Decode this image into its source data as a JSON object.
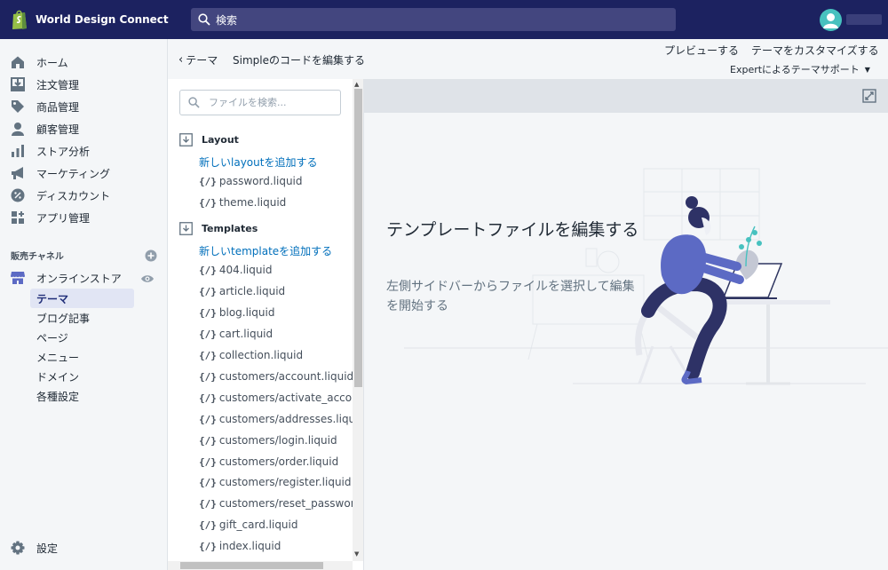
{
  "topbar": {
    "store_name": "World Design Connect",
    "search_label": "検索",
    "colors": {
      "bg": "#1c2260",
      "search_bg": "#43467f",
      "avatar": "#47c1bf"
    }
  },
  "nav": {
    "items": [
      {
        "label": "ホーム",
        "icon": "home-icon"
      },
      {
        "label": "注文管理",
        "icon": "orders-icon"
      },
      {
        "label": "商品管理",
        "icon": "tag-icon"
      },
      {
        "label": "顧客管理",
        "icon": "person-icon"
      },
      {
        "label": "ストア分析",
        "icon": "bar-chart-icon"
      },
      {
        "label": "マーケティング",
        "icon": "megaphone-icon"
      },
      {
        "label": "ディスカウント",
        "icon": "discount-icon"
      },
      {
        "label": "アプリ管理",
        "icon": "apps-icon"
      }
    ],
    "channels_heading": "販売チャネル",
    "online_store": "オンラインストア",
    "sub_items": [
      "テーマ",
      "ブログ記事",
      "ページ",
      "メニュー",
      "ドメイン",
      "各種設定"
    ],
    "settings": "設定"
  },
  "header": {
    "back_label": "テーマ",
    "title": "Simpleのコードを編集する",
    "preview": "プレビューする",
    "customize": "テーマをカスタマイズする",
    "expert": "Expertによるテーマサポート"
  },
  "files": {
    "search_placeholder": "ファイルを検索...",
    "layout": {
      "heading": "Layout",
      "add": "新しいlayoutを追加する",
      "items": [
        "password.liquid",
        "theme.liquid"
      ]
    },
    "templates": {
      "heading": "Templates",
      "add": "新しいtemplateを追加する",
      "items": [
        "404.liquid",
        "article.liquid",
        "blog.liquid",
        "cart.liquid",
        "collection.liquid",
        "customers/account.liquid",
        "customers/activate_account.li",
        "customers/addresses.liquid",
        "customers/login.liquid",
        "customers/order.liquid",
        "customers/register.liquid",
        "customers/reset_password.liq",
        "gift_card.liquid",
        "index.liquid"
      ]
    },
    "liquid_icon": "{/}"
  },
  "editor": {
    "empty_title": "テンプレートファイルを編集する",
    "empty_desc": "左側サイドバーからファイルを選択して編集を開始する"
  }
}
